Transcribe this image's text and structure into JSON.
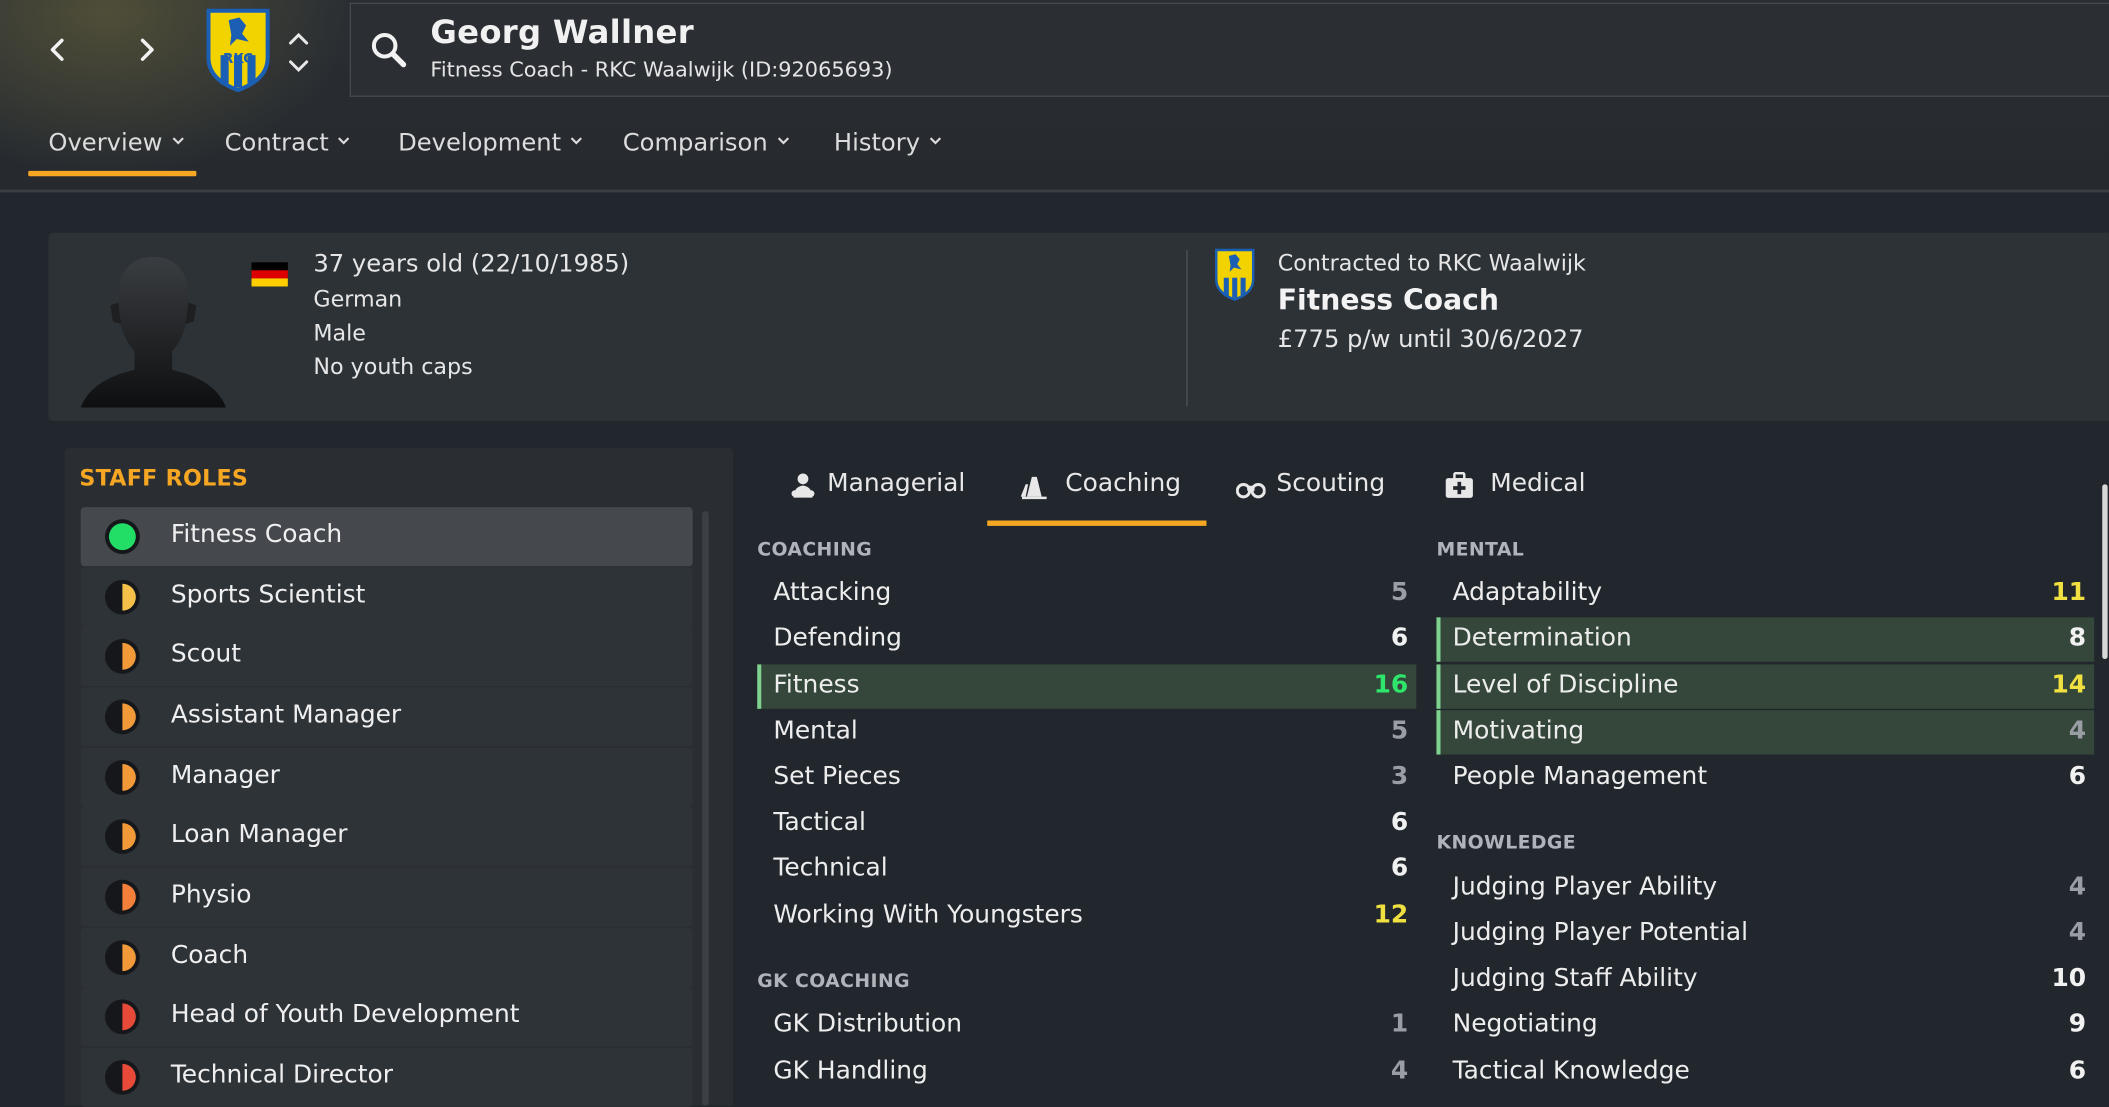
{
  "header": {
    "name": "Georg Wallner",
    "subtitle": "Fitness Coach - RKC Waalwijk (ID:92065693)",
    "club_crest_text": "RKC",
    "tabs": [
      {
        "label": "Overview"
      },
      {
        "label": "Contract"
      },
      {
        "label": "Development"
      },
      {
        "label": "Comparison"
      },
      {
        "label": "History"
      }
    ],
    "active_tab": "Overview"
  },
  "profile": {
    "age_line": "37 years old (22/10/1985)",
    "nationality": "German",
    "gender": "Male",
    "caps": "No youth caps",
    "flag_colors": [
      "#000000",
      "#dd0000",
      "#ffce00"
    ],
    "contract_line": "Contracted to RKC Waalwijk",
    "role": "Fitness Coach",
    "wage": "£775 p/w until 30/6/2027"
  },
  "staff_roles": {
    "title": "STAFF ROLES",
    "items": [
      {
        "label": "Fitness Coach",
        "suitability": 1.0,
        "color": "#22dd66"
      },
      {
        "label": "Sports Scientist",
        "suitability": 0.5,
        "color": "#f5c04a"
      },
      {
        "label": "Scout",
        "suitability": 0.5,
        "color": "#f29a3a"
      },
      {
        "label": "Assistant Manager",
        "suitability": 0.5,
        "color": "#f29a3a"
      },
      {
        "label": "Manager",
        "suitability": 0.5,
        "color": "#f29a3a"
      },
      {
        "label": "Loan Manager",
        "suitability": 0.5,
        "color": "#f29a3a"
      },
      {
        "label": "Physio",
        "suitability": 0.5,
        "color": "#f27f3a"
      },
      {
        "label": "Coach",
        "suitability": 0.5,
        "color": "#f29a3a"
      },
      {
        "label": "Head of Youth Development",
        "suitability": 0.5,
        "color": "#e84a3a"
      },
      {
        "label": "Technical Director",
        "suitability": 0.5,
        "color": "#e84a3a"
      }
    ]
  },
  "attribute_tabs": [
    {
      "label": "Managerial",
      "icon": "managerial-icon"
    },
    {
      "label": "Coaching",
      "icon": "coaching-cone-icon"
    },
    {
      "label": "Scouting",
      "icon": "binoculars-icon"
    },
    {
      "label": "Medical",
      "icon": "medical-kit-icon"
    }
  ],
  "active_attribute_tab": "Coaching",
  "coaching": {
    "title": "COACHING",
    "items": [
      {
        "name": "Attacking",
        "value": "5",
        "color": "#9a9ea4"
      },
      {
        "name": "Defending",
        "value": "6",
        "color": "#f1f1f1"
      },
      {
        "name": "Fitness",
        "value": "16",
        "color": "#2ee66b",
        "highlight": true
      },
      {
        "name": "Mental",
        "value": "5",
        "color": "#9a9ea4"
      },
      {
        "name": "Set Pieces",
        "value": "3",
        "color": "#9a9ea4"
      },
      {
        "name": "Tactical",
        "value": "6",
        "color": "#f1f1f1"
      },
      {
        "name": "Technical",
        "value": "6",
        "color": "#f1f1f1"
      },
      {
        "name": "Working With Youngsters",
        "value": "12",
        "color": "#f0e040"
      }
    ]
  },
  "gk_coaching": {
    "title": "GK COACHING",
    "items": [
      {
        "name": "GK Distribution",
        "value": "1",
        "color": "#9a9ea4"
      },
      {
        "name": "GK Handling",
        "value": "4",
        "color": "#9a9ea4"
      }
    ]
  },
  "mental": {
    "title": "MENTAL",
    "items": [
      {
        "name": "Adaptability",
        "value": "11",
        "color": "#f0e040"
      },
      {
        "name": "Determination",
        "value": "8",
        "color": "#f1f1f1",
        "highlight": true
      },
      {
        "name": "Level of Discipline",
        "value": "14",
        "color": "#f0e040",
        "highlight": true
      },
      {
        "name": "Motivating",
        "value": "4",
        "color": "#9a9ea4",
        "highlight": true
      },
      {
        "name": "People Management",
        "value": "6",
        "color": "#f1f1f1"
      }
    ]
  },
  "knowledge": {
    "title": "KNOWLEDGE",
    "items": [
      {
        "name": "Judging Player Ability",
        "value": "4",
        "color": "#9a9ea4"
      },
      {
        "name": "Judging Player Potential",
        "value": "4",
        "color": "#9a9ea4"
      },
      {
        "name": "Judging Staff Ability",
        "value": "10",
        "color": "#f1f1f1"
      },
      {
        "name": "Negotiating",
        "value": "9",
        "color": "#f1f1f1"
      },
      {
        "name": "Tactical Knowledge",
        "value": "6",
        "color": "#f1f1f1"
      }
    ]
  }
}
